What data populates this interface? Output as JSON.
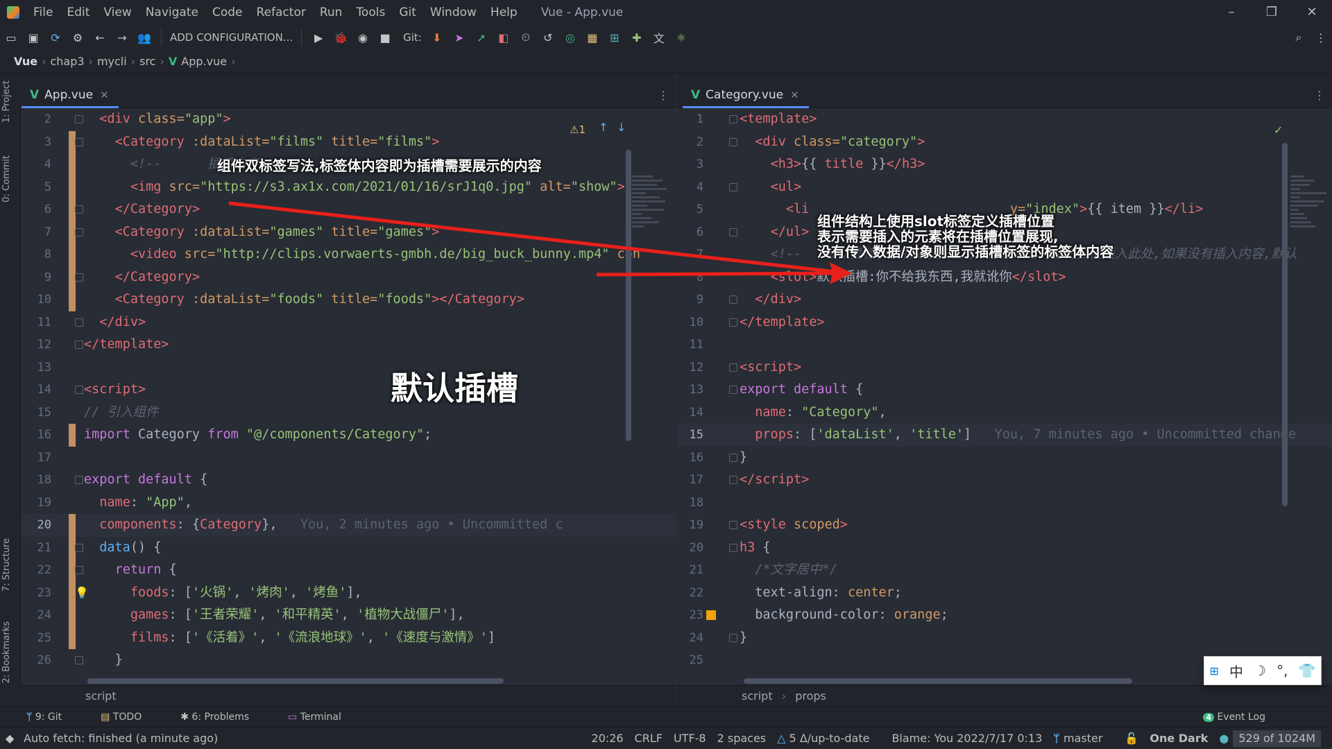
{
  "window": {
    "menu": [
      "File",
      "Edit",
      "View",
      "Navigate",
      "Code",
      "Refactor",
      "Run",
      "Tools",
      "Git",
      "Window",
      "Help"
    ],
    "title": "Vue - App.vue",
    "controls": [
      "–",
      "❐",
      "✕"
    ]
  },
  "toolbar": {
    "add_config": "ADD CONFIGURATION...",
    "git_label": "Git:"
  },
  "breadcrumb": [
    "Vue",
    "chap3",
    "mycli",
    "src",
    "App.vue"
  ],
  "left_tabs": [
    "1: Project",
    "0: Commit",
    "7: Structure",
    "2: Bookmarks"
  ],
  "left_editor": {
    "tab": "App.vue",
    "warning": "⚠1",
    "crumb": "script",
    "lines": [
      {
        "n": "2",
        "html": "  <span class='tag'>&lt;div</span> <span class='attr'>class=</span><span class='str'>\"app\"</span><span class='tag'>&gt;</span>"
      },
      {
        "n": "3",
        "html": "    <span class='tag'>&lt;Category</span> <span class='attr'>:dataList=</span><span class='str'>\"films\"</span> <span class='attr'>title=</span><span class='str'>\"films\"</span><span class='tag'>&gt;</span>"
      },
      {
        "n": "4",
        "html": "      <span class='cm'>&lt;!--      插槽内容--&gt;</span>"
      },
      {
        "n": "5",
        "html": "      <span class='tag'>&lt;img</span> <span class='attr'>src=</span><span class='str'>\"https://s3.ax1x.com/2021/01/16/srJ1q0.jpg\"</span> <span class='attr'>alt=</span><span class='str'>\"show\"</span><span class='tag'>&gt;</span>"
      },
      {
        "n": "6",
        "html": "    <span class='tag'>&lt;/Category&gt;</span>"
      },
      {
        "n": "7",
        "html": "    <span class='tag'>&lt;Category</span> <span class='attr'>:dataList=</span><span class='str'>\"games\"</span> <span class='attr'>title=</span><span class='str'>\"games\"</span><span class='tag'>&gt;</span>"
      },
      {
        "n": "8",
        "html": "      <span class='tag'>&lt;video</span> <span class='attr'>src=</span><span class='str'>\"http://clips.vorwaerts-gmbh.de/big_buck_bunny.mp4\"</span> <span class='attr'>con</span>"
      },
      {
        "n": "9",
        "html": "    <span class='tag'>&lt;/Category&gt;</span>"
      },
      {
        "n": "10",
        "html": "    <span class='tag'>&lt;Category</span> <span class='attr'>:dataList=</span><span class='str'>\"foods\"</span> <span class='attr'>title=</span><span class='str'>\"foods\"</span><span class='tag'>&gt;&lt;/Category&gt;</span>"
      },
      {
        "n": "11",
        "html": "  <span class='tag'>&lt;/div&gt;</span>"
      },
      {
        "n": "12",
        "html": "<span class='tag'>&lt;/template&gt;</span>"
      },
      {
        "n": "13",
        "html": ""
      },
      {
        "n": "14",
        "html": "<span class='tag'>&lt;script&gt;</span>"
      },
      {
        "n": "15",
        "html": "<span class='cm'>// 引入组件</span>"
      },
      {
        "n": "16",
        "html": "<span class='kw'>import</span> <span class='pl'>Category</span> <span class='kw'>from</span> <span class='str'>\"@/components/Category\"</span><span class='pl'>;</span>"
      },
      {
        "n": "17",
        "html": ""
      },
      {
        "n": "18",
        "html": "<span class='kw'>export default</span> <span class='pl'>{</span>"
      },
      {
        "n": "19",
        "html": "  <span class='prop'>name</span><span class='pl'>: </span><span class='str'>\"App\"</span><span class='pl'>,</span>"
      },
      {
        "n": "20",
        "html": "  <span class='prop'>components</span><span class='pl'>: {</span><span class='prop'>Category</span><span class='pl'>},</span>   <span class='blame'>You, 2 minutes ago • Uncommitted c</span>"
      },
      {
        "n": "21",
        "html": "  <span class='fn'>data</span><span class='pl'>() {</span>"
      },
      {
        "n": "22",
        "html": "    <span class='kw'>return</span> <span class='pl'>{</span>"
      },
      {
        "n": "23",
        "html": "      <span class='prop'>foods</span><span class='pl'>: [</span><span class='str'>'火锅'</span><span class='pl'>, </span><span class='str'>'烤肉'</span><span class='pl'>, </span><span class='str'>'烤鱼'</span><span class='pl'>],</span>"
      },
      {
        "n": "24",
        "html": "      <span class='prop'>games</span><span class='pl'>: [</span><span class='str'>'王者荣耀'</span><span class='pl'>, </span><span class='str'>'和平精英'</span><span class='pl'>, </span><span class='str'>'植物大战僵尸'</span><span class='pl'>],</span>"
      },
      {
        "n": "25",
        "html": "      <span class='prop'>films</span><span class='pl'>: [</span><span class='str'>'《活着》'</span><span class='pl'>, </span><span class='str'>'《流浪地球》'</span><span class='pl'>, </span><span class='str'>'《速度与激情》'</span><span class='pl'>]</span>"
      },
      {
        "n": "26",
        "html": "    <span class='pl'>}</span>"
      }
    ]
  },
  "right_editor": {
    "tab": "Category.vue",
    "crumbs": [
      "script",
      "props"
    ],
    "lines": [
      {
        "n": "1",
        "html": "<span class='tag'>&lt;template&gt;</span>"
      },
      {
        "n": "2",
        "html": "  <span class='tag'>&lt;div</span> <span class='attr'>class=</span><span class='str'>\"category\"</span><span class='tag'>&gt;</span>"
      },
      {
        "n": "3",
        "html": "    <span class='tag'>&lt;h3&gt;</span><span class='pl'>{{ </span><span class='prop'>title</span><span class='pl'> }}</span><span class='tag'>&lt;/h3&gt;</span>"
      },
      {
        "n": "4",
        "html": "    <span class='tag'>&lt;ul&gt;</span>"
      },
      {
        "n": "5",
        "html": "      <span class='tag'>&lt;li</span>                          <span class='attr'>y=</span><span class='str'>\"index\"</span><span class='tag'>&gt;</span><span class='pl'>{{ item }}</span><span class='tag'>&lt;/li&gt;</span>"
      },
      {
        "n": "6",
        "html": "    <span class='tag'>&lt;/ul&gt;</span>"
      },
      {
        "n": "7",
        "html": "    <span class='cm'>&lt;!--   默认插槽,组件双标签之间传递进来的内容将会被插入此处,如果没有插入内容,默认</span>"
      },
      {
        "n": "8",
        "html": "    <span class='tag'>&lt;slot&gt;</span><span class='pl'>默认插槽:你不给我东西,我就讹你</span><span class='tag'>&lt;/slot&gt;</span>"
      },
      {
        "n": "9",
        "html": "  <span class='tag'>&lt;/div&gt;</span>"
      },
      {
        "n": "10",
        "html": "<span class='tag'>&lt;/template&gt;</span>"
      },
      {
        "n": "11",
        "html": ""
      },
      {
        "n": "12",
        "html": "<span class='tag'>&lt;script&gt;</span>"
      },
      {
        "n": "13",
        "html": "<span class='kw'>export default</span> <span class='pl'>{</span>"
      },
      {
        "n": "14",
        "html": "  <span class='prop'>name</span><span class='pl'>: </span><span class='str'>\"Category\"</span><span class='pl'>,</span>"
      },
      {
        "n": "15",
        "html": "  <span class='prop'>props</span><span class='pl'>: [</span><span class='str'>'dataList'</span><span class='pl'>, </span><span class='str'>'title'</span><span class='pl'>]</span>   <span class='blame'>You, 7 minutes ago • Uncommitted change</span>"
      },
      {
        "n": "16",
        "html": "<span class='pl'>}</span>"
      },
      {
        "n": "17",
        "html": "<span class='tag'>&lt;/script&gt;</span>"
      },
      {
        "n": "18",
        "html": ""
      },
      {
        "n": "19",
        "html": "<span class='tag'>&lt;style</span> <span class='attr'>scoped</span><span class='tag'>&gt;</span>"
      },
      {
        "n": "20",
        "html": "<span class='tag'>h3</span> <span class='pl'>{</span>"
      },
      {
        "n": "21",
        "html": "  <span class='cm'>/*文字居中*/</span>"
      },
      {
        "n": "22",
        "html": "  <span class='pl'>text-align: </span><span class='val'>center</span><span class='pl'>;</span>"
      },
      {
        "n": "23",
        "html": "  <span class='pl'>background-color: </span><span class='val'>orange</span><span class='pl'>;</span>"
      },
      {
        "n": "24",
        "html": "<span class='pl'>}</span>"
      },
      {
        "n": "25",
        "html": ""
      }
    ]
  },
  "annotations": {
    "left_note": "组件双标签写法,标签体内容即为插槽需要展示的内容",
    "title": "默认插槽",
    "right_note": [
      "组件结构上使用slot标签定义插槽位置",
      "表示需要插入的元素将在插槽位置展现,",
      "没有传入数据/对象则显示插槽标签的标签体内容"
    ]
  },
  "tool_windows": [
    "9: Git",
    "TODO",
    "6: Problems",
    "Terminal"
  ],
  "event_log": "Event Log",
  "event_count": "4",
  "status": {
    "left": "Auto fetch: finished (a minute ago)",
    "right": [
      "20:26",
      "CRLF",
      "UTF-8",
      "2 spaces",
      "5 Δ/up-to-date",
      "Blame: You 2022/7/17 0:13",
      "master",
      "One Dark"
    ],
    "memory": "529 of 1024M"
  },
  "ime": [
    "中",
    "☽",
    "°,",
    "👕"
  ],
  "colors": {
    "accent": "#568af2",
    "vue": "#41b883",
    "annotation_arrow": "#e8201b"
  }
}
